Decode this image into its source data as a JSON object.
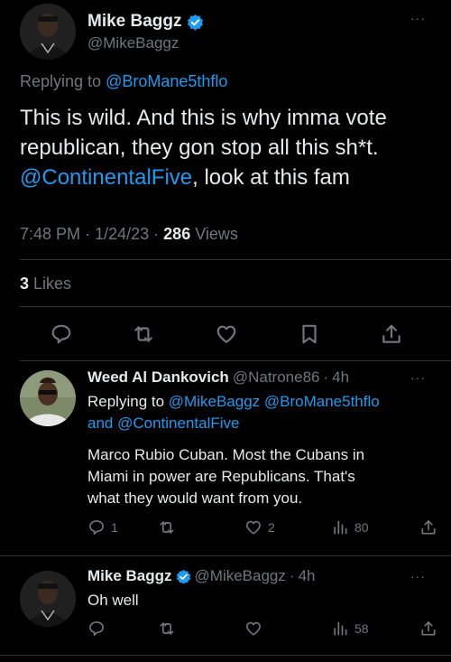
{
  "main_tweet": {
    "author_name": "Mike Baggz",
    "author_handle": "@MikeBaggz",
    "more_label": "···",
    "replying_prefix": "Replying to",
    "replying_to": "@BroMane5thflo",
    "text_line1": "This is wild. And this is why imma vote",
    "text_line2": "republican, they gon stop all this sh*t.",
    "mention": "@ContinentalFive",
    "text_line3_rest": ", look at this fam",
    "time": "7:48 PM",
    "date": "1/24/23",
    "views_count": "286",
    "views_label": "Views",
    "likes_count": "3",
    "likes_label": "Likes"
  },
  "replies": [
    {
      "name": "Weed Al Dankovich",
      "handle": "@Natrone86",
      "time": "4h",
      "replying_prefix": "Replying to",
      "replying_to_1": "@MikeBaggz",
      "replying_to_2": "@BroMane5thflo",
      "replying_and": "and",
      "replying_to_3": "@ContinentalFive",
      "text_line1": "Marco Rubio Cuban. Most the Cubans in",
      "text_line2": "Miami in power are Republicans. That's",
      "text_line3": "what they would want from you.",
      "reply_count": "1",
      "like_count": "2",
      "views_count": "80"
    },
    {
      "name": "Mike Baggz",
      "handle": "@MikeBaggz",
      "time": "4h",
      "text_line1": "Oh well",
      "views_count": "58"
    }
  ],
  "separators": {
    "dot": "·"
  },
  "colors": {
    "accent": "#1d9bf0",
    "verified": "#1d9bf0",
    "secondary_text": "#71767b",
    "background": "#000000"
  }
}
